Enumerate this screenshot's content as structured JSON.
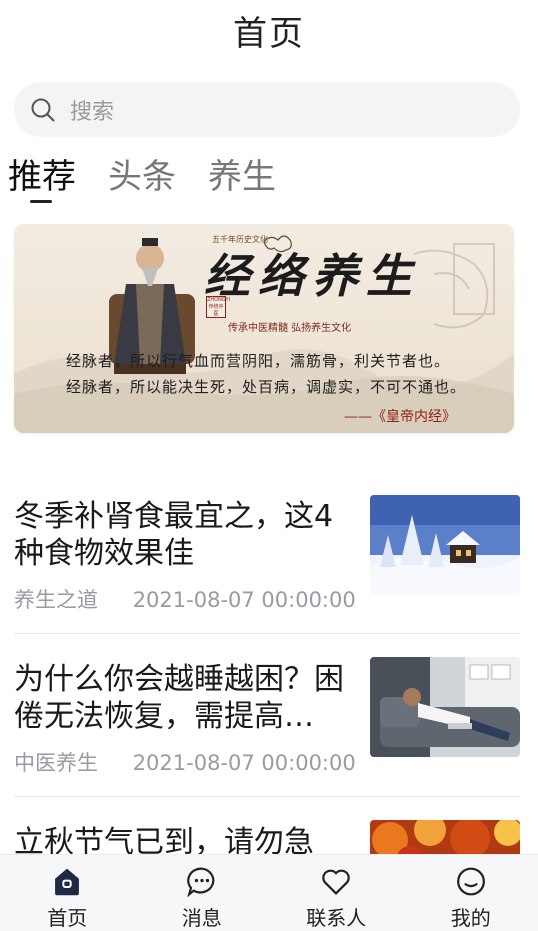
{
  "header": {
    "title": "首页"
  },
  "search": {
    "placeholder": "搜索"
  },
  "tabs": [
    {
      "label": "推荐",
      "active": true
    },
    {
      "label": "头条",
      "active": false
    },
    {
      "label": "养生",
      "active": false
    }
  ],
  "banner": {
    "title": "经络养生",
    "top_small": "五千年历史文化",
    "seal": "ZHONGYI 传统中医",
    "subtitle": "传承中医精髓   弘扬养生文化",
    "line1": "经脉者，所以行气血而营阴阳，濡筋骨，利关节者也。",
    "line2": "经脉者，所以能决生死，处百病，调虚实，不可不通也。",
    "quote": "——《皇帝内经》"
  },
  "articles": [
    {
      "title": "冬季补肾食最宜之，这4种食物效果佳",
      "source": "养生之道",
      "date": "2021-08-07 00:00:00",
      "thumb": "snow-cabin"
    },
    {
      "title": "为什么你会越睡越困？困倦无法恢复，需提高…",
      "source": "中医养生",
      "date": "2021-08-07 00:00:00",
      "thumb": "man-sleeping-sofa"
    },
    {
      "title": "立秋节气已到，请勿急",
      "source": "",
      "date": "",
      "thumb": "autumn-leaves"
    }
  ],
  "nav": [
    {
      "label": "首页",
      "icon": "home-icon",
      "active": true
    },
    {
      "label": "消息",
      "icon": "message-icon",
      "active": false
    },
    {
      "label": "联系人",
      "icon": "heart-icon",
      "active": false
    },
    {
      "label": "我的",
      "icon": "profile-icon",
      "active": false
    }
  ],
  "colors": {
    "accent": "#1f2a44",
    "muted": "#9a9aa2",
    "search_bg": "#f4f4f6"
  }
}
